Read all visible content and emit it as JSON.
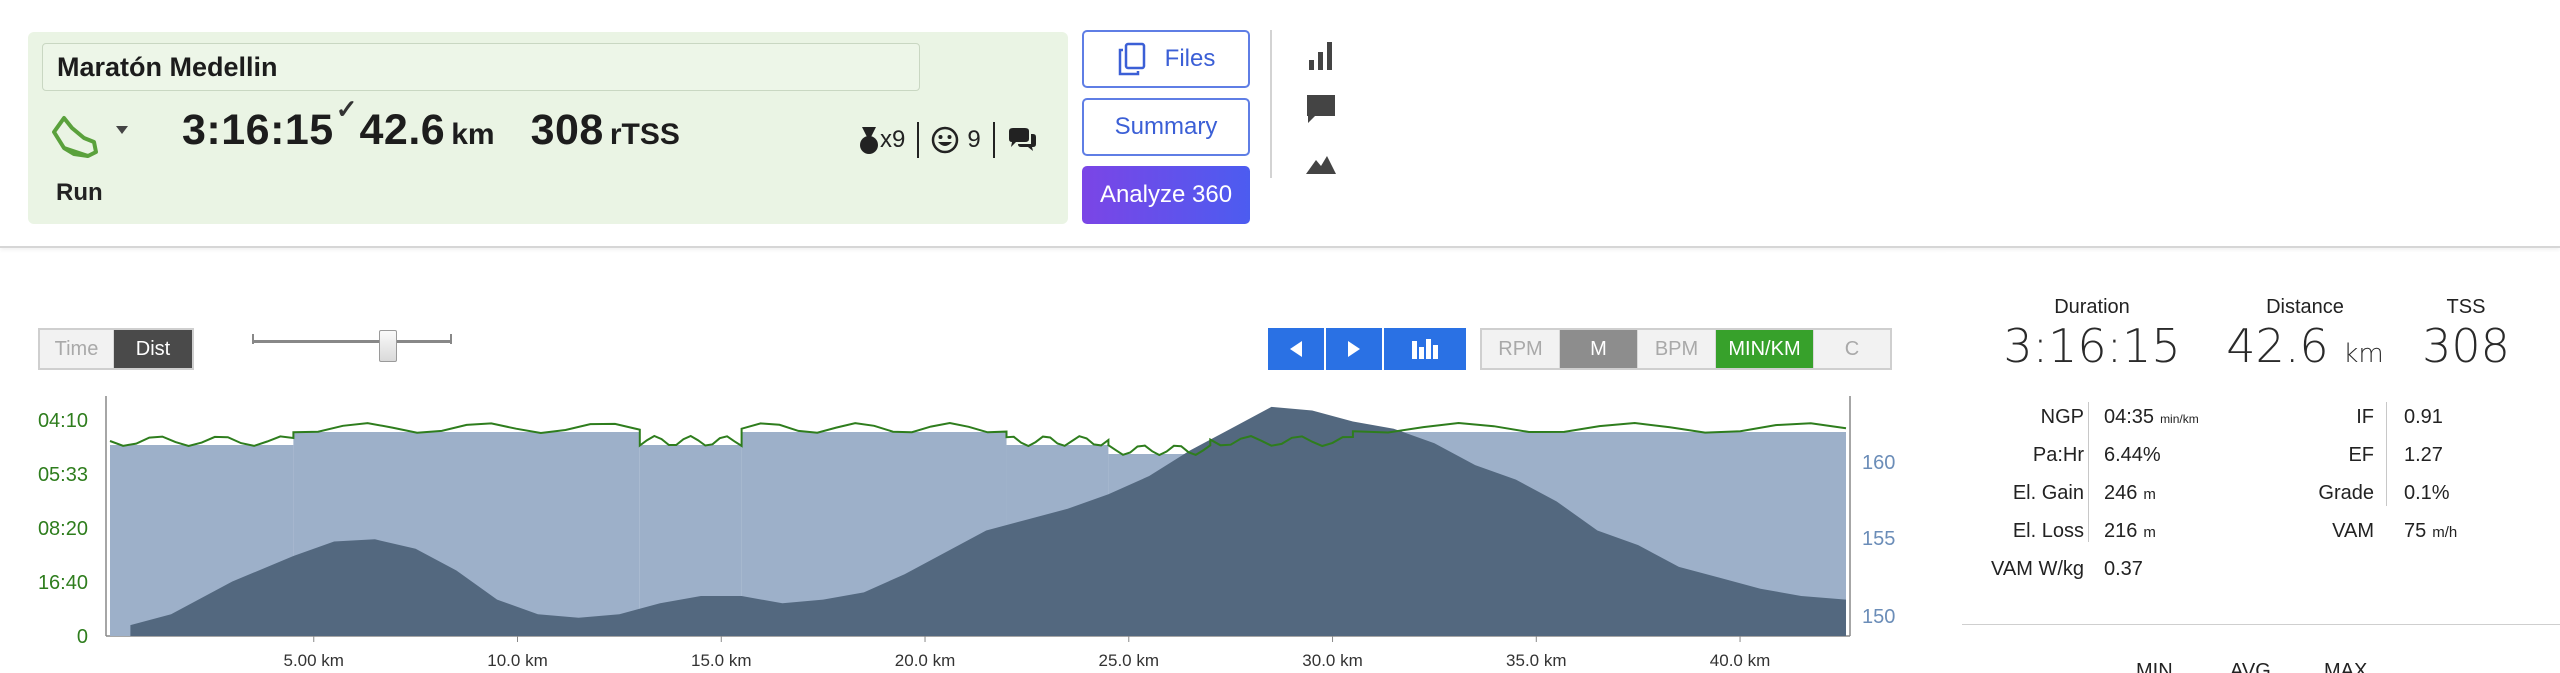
{
  "activity": {
    "title": "Maratón Medellin",
    "sport": "Run",
    "duration": "3:16:15",
    "distance": "42.6",
    "distance_unit": "km",
    "tss": "308",
    "tss_unit": "rTSS",
    "badges": {
      "medals": "x9",
      "smiles": "9"
    }
  },
  "buttons": {
    "files": "Files",
    "summary": "Summary",
    "analyze": "Analyze 360"
  },
  "side_icons": [
    "bar-chart-icon",
    "comment-icon",
    "mountain-icon"
  ],
  "chart_controls": {
    "axis_toggle": [
      {
        "label": "Time",
        "active": false
      },
      {
        "label": "Dist",
        "active": true
      }
    ],
    "zoom_level": 0.68,
    "metric_toggle": [
      {
        "label": "RPM",
        "active": false
      },
      {
        "label": "M",
        "active": true
      },
      {
        "label": "BPM",
        "active": false
      },
      {
        "label": "MIN/KM",
        "active": true,
        "highlight": true
      },
      {
        "label": "C",
        "active": false
      }
    ]
  },
  "colors": {
    "pace": "#2e7d1d",
    "elevation": "#53687f",
    "pace_fill": "#9db0c9",
    "accent": "#2a71e4",
    "green_btn": "#37a12b"
  },
  "chart_data": {
    "type": "area",
    "x_unit": "km",
    "x_ticks": [
      "5.00 km",
      "10.0 km",
      "15.0 km",
      "20.0 km",
      "25.0 km",
      "30.0 km",
      "35.0 km",
      "40.0 km"
    ],
    "xlim": [
      0,
      42.6
    ],
    "y_left_ticks": [
      "04:10",
      "05:33",
      "08:20",
      "16:40",
      "0"
    ],
    "y_right_ticks": [
      "160",
      "155",
      "150"
    ],
    "elevation": {
      "x": [
        0.5,
        1.5,
        3,
        4.5,
        5.5,
        6.5,
        7.5,
        8.5,
        9.5,
        10.5,
        11.5,
        12.5,
        13.5,
        14.5,
        15.5,
        16.5,
        17.5,
        18.5,
        19.5,
        20.5,
        21.5,
        22.5,
        23.5,
        24.5,
        25.5,
        26.5,
        27.5,
        28.5,
        29.5,
        30.5,
        31.5,
        32.5,
        33.5,
        34.5,
        35.5,
        36.5,
        37.5,
        38.5,
        39.5,
        40.5,
        41.5,
        42.6
      ],
      "y": [
        1500.5,
        1502,
        1506.5,
        1510,
        1512,
        1512.3,
        1511,
        1508,
        1504,
        1502,
        1501.5,
        1502,
        1503.5,
        1504.5,
        1504.5,
        1503.5,
        1504,
        1505,
        1507.5,
        1510.5,
        1513.5,
        1515,
        1516.5,
        1518.5,
        1521,
        1524.5,
        1527.5,
        1530.5,
        1530,
        1528.5,
        1527.5,
        1525.5,
        1522.5,
        1520.5,
        1517.5,
        1513.5,
        1511.5,
        1508.5,
        1507,
        1505.5,
        1504.5,
        1504
      ]
    },
    "pace_band": {
      "x": [
        0,
        4.5,
        13,
        15.5,
        22,
        24.5,
        27,
        30.5,
        42.6
      ],
      "pace": [
        "05:33",
        "05:10",
        "05:33",
        "05:10",
        "05:33",
        "05:40",
        "05:33",
        "05:10",
        "05:10"
      ]
    }
  },
  "summary": {
    "duration_label": "Duration",
    "duration": "3:16:15",
    "distance_label": "Distance",
    "distance": "42.6",
    "distance_unit": "km",
    "tss_label": "TSS",
    "tss": "308",
    "rows_left": [
      {
        "label": "NGP",
        "value": "04:35",
        "unit": "min/km"
      },
      {
        "label": "Pa:Hr",
        "value": "6.44%",
        "unit": ""
      },
      {
        "label": "El. Gain",
        "value": "246",
        "unit": "m"
      },
      {
        "label": "El. Loss",
        "value": "216",
        "unit": "m"
      },
      {
        "label": "VAM W/kg",
        "value": "0.37",
        "unit": ""
      }
    ],
    "rows_right": [
      {
        "label": "IF",
        "value": "0.91",
        "unit": ""
      },
      {
        "label": "EF",
        "value": "1.27",
        "unit": ""
      },
      {
        "label": "Grade",
        "value": "0.1%",
        "unit": ""
      },
      {
        "label": "VAM",
        "value": "75",
        "unit": "m/h"
      }
    ],
    "table_headers": [
      "MIN",
      "AVG",
      "MAX"
    ]
  }
}
